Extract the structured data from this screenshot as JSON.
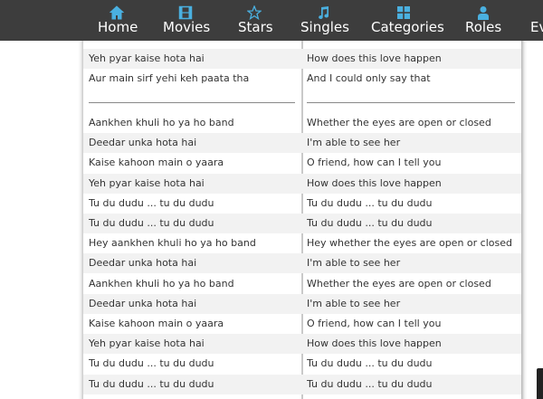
{
  "nav": {
    "items": [
      {
        "label": "Home",
        "icon": "home-icon"
      },
      {
        "label": "Movies",
        "icon": "film-icon"
      },
      {
        "label": "Stars",
        "icon": "star-icon"
      },
      {
        "label": "Singles",
        "icon": "music-note-icon"
      },
      {
        "label": "Categories",
        "icon": "grid-icon"
      },
      {
        "label": "Roles",
        "icon": "user-icon"
      },
      {
        "label": "Ev",
        "icon": ""
      }
    ]
  },
  "lyrics": {
    "top_rows": [
      {
        "hindi": "Yeh pyar kaise hota hai",
        "english": "How does this love happen"
      },
      {
        "hindi": "Aur main sirf yehi keh paata tha",
        "english": "And I could only say that"
      }
    ],
    "rows": [
      {
        "hindi": "Aankhen khuli ho ya ho band",
        "english": "Whether the eyes are open or closed"
      },
      {
        "hindi": "Deedar unka hota hai",
        "english": "I'm able to see her"
      },
      {
        "hindi": "Kaise kahoon main o yaara",
        "english": "O friend, how can I tell you"
      },
      {
        "hindi": "Yeh pyar kaise hota hai",
        "english": "How does this love happen"
      },
      {
        "hindi": "Tu du dudu ... tu du dudu",
        "english": "Tu du dudu ... tu du dudu"
      },
      {
        "hindi": "Tu du dudu ... tu du dudu",
        "english": "Tu du dudu ... tu du dudu"
      },
      {
        "hindi": "Hey aankhen khuli ho ya ho band",
        "english": "Hey whether the eyes are open or closed"
      },
      {
        "hindi": "Deedar unka hota hai",
        "english": "I'm able to see her"
      },
      {
        "hindi": "Aankhen khuli ho ya ho band",
        "english": "Whether the eyes are open or closed"
      },
      {
        "hindi": "Deedar unka hota hai",
        "english": "I'm able to see her"
      },
      {
        "hindi": "Kaise kahoon main o yaara",
        "english": "O friend, how can I tell you"
      },
      {
        "hindi": "Yeh pyar kaise hota hai",
        "english": "How does this love happen"
      },
      {
        "hindi": "Tu du dudu ... tu du dudu",
        "english": "Tu du dudu ... tu du dudu"
      },
      {
        "hindi": "Tu du dudu ... tu du dudu",
        "english": "Tu du dudu ... tu du dudu"
      }
    ]
  },
  "colors": {
    "nav_bg": "#3d3d3d",
    "nav_icon": "#4ab0e0",
    "row_alt": "#f2f2f2"
  }
}
